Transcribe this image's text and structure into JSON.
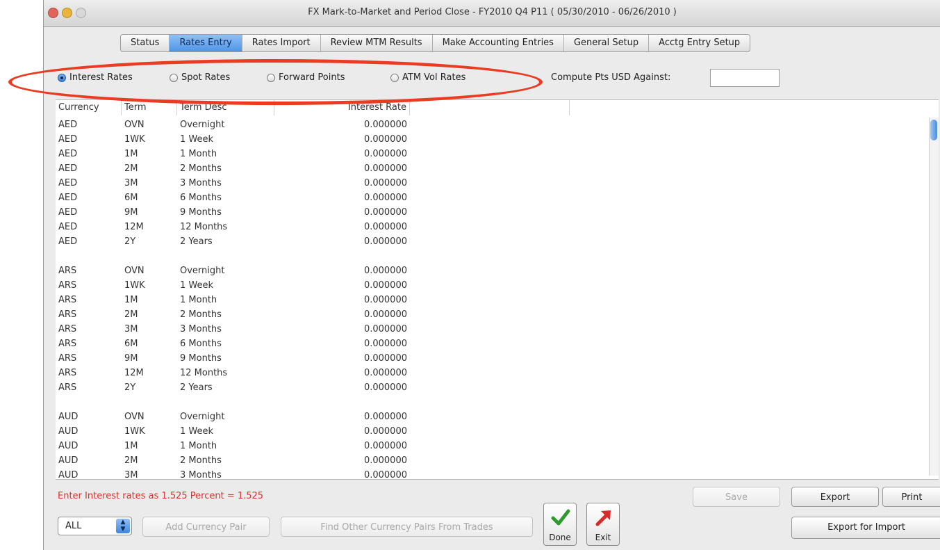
{
  "window": {
    "title": "FX Mark-to-Market and Period Close - FY2010 Q4 P11  ( 05/30/2010 - 06/26/2010 )"
  },
  "tabs": [
    {
      "label": "Status",
      "active": false
    },
    {
      "label": "Rates Entry",
      "active": true
    },
    {
      "label": "Rates Import",
      "active": false
    },
    {
      "label": "Review MTM Results",
      "active": false
    },
    {
      "label": "Make Accounting Entries",
      "active": false
    },
    {
      "label": "General Setup",
      "active": false
    },
    {
      "label": "Acctg Entry Setup",
      "active": false
    }
  ],
  "rate_types": [
    {
      "label": "Interest Rates",
      "selected": true
    },
    {
      "label": "Spot Rates",
      "selected": false
    },
    {
      "label": "Forward Points",
      "selected": false
    },
    {
      "label": "ATM Vol Rates",
      "selected": false
    }
  ],
  "compute": {
    "label": "Compute Pts USD Against:",
    "value": ""
  },
  "table": {
    "columns": [
      "Currency",
      "Term",
      "Term Desc",
      "Interest Rate"
    ],
    "groups": [
      {
        "currency": "AED",
        "rows": [
          [
            "AED",
            "OVN",
            "Overnight",
            "0.000000"
          ],
          [
            "AED",
            "1WK",
            "1 Week",
            "0.000000"
          ],
          [
            "AED",
            "1M",
            "1 Month",
            "0.000000"
          ],
          [
            "AED",
            "2M",
            "2 Months",
            "0.000000"
          ],
          [
            "AED",
            "3M",
            "3 Months",
            "0.000000"
          ],
          [
            "AED",
            "6M",
            "6 Months",
            "0.000000"
          ],
          [
            "AED",
            "9M",
            "9 Months",
            "0.000000"
          ],
          [
            "AED",
            "12M",
            "12 Months",
            "0.000000"
          ],
          [
            "AED",
            "2Y",
            "2 Years",
            "0.000000"
          ]
        ]
      },
      {
        "currency": "ARS",
        "rows": [
          [
            "ARS",
            "OVN",
            "Overnight",
            "0.000000"
          ],
          [
            "ARS",
            "1WK",
            "1 Week",
            "0.000000"
          ],
          [
            "ARS",
            "1M",
            "1 Month",
            "0.000000"
          ],
          [
            "ARS",
            "2M",
            "2 Months",
            "0.000000"
          ],
          [
            "ARS",
            "3M",
            "3 Months",
            "0.000000"
          ],
          [
            "ARS",
            "6M",
            "6 Months",
            "0.000000"
          ],
          [
            "ARS",
            "9M",
            "9 Months",
            "0.000000"
          ],
          [
            "ARS",
            "12M",
            "12 Months",
            "0.000000"
          ],
          [
            "ARS",
            "2Y",
            "2 Years",
            "0.000000"
          ]
        ]
      },
      {
        "currency": "AUD",
        "rows": [
          [
            "AUD",
            "OVN",
            "Overnight",
            "0.000000"
          ],
          [
            "AUD",
            "1WK",
            "1 Week",
            "0.000000"
          ],
          [
            "AUD",
            "1M",
            "1 Month",
            "0.000000"
          ],
          [
            "AUD",
            "2M",
            "2 Months",
            "0.000000"
          ],
          [
            "AUD",
            "3M",
            "3 Months",
            "0.000000"
          ]
        ]
      }
    ]
  },
  "hint": "Enter Interest rates as 1.525 Percent = 1.525",
  "filter": {
    "value": "ALL"
  },
  "buttons": {
    "add_pair": "Add Currency Pair",
    "find_pairs": "Find Other Currency Pairs From Trades",
    "done": "Done",
    "exit": "Exit",
    "save": "Save",
    "export": "Export",
    "print": "Print",
    "export_import": "Export for Import"
  },
  "colors": {
    "annotation": "#ea3c22",
    "hint_text": "#d8312a",
    "tab_active": "#4f95e6",
    "done_check": "#2e9a2e",
    "exit_arrow": "#d92a2a"
  },
  "icons": {
    "done": "checkmark-icon",
    "exit": "arrow-up-right-icon"
  }
}
